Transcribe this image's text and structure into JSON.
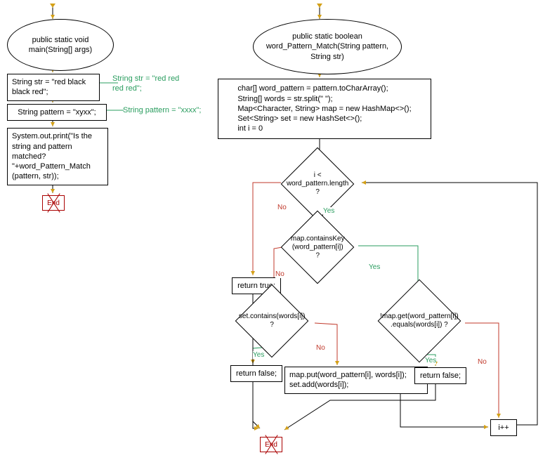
{
  "left": {
    "entry": "public static void main(String[] args)",
    "step1": "String str = \"red black black red\";",
    "step2": "String pattern = \"xyxx\";",
    "step3": "System.out.print(\"Is the string and pattern matched? \"+word_Pattern_Match (pattern, str));",
    "end": "End",
    "note1": "String str = \"red red red red\";",
    "note2": "String pattern = \"xxxx\";"
  },
  "right": {
    "entry": "public static boolean word_Pattern_Match(String pattern, String str)",
    "init": "char[] word_pattern = pattern.toCharArray();\nString[] words = str.split(\" \");\nMap<Character, String> map = new HashMap<>();\nSet<String> set = new HashSet<>();\nint i = 0",
    "cond1": "i < word_pattern.length ?",
    "cond2": "map.containsKey (word_pattern[i]) ?",
    "cond3": "set.contains(words[i]) ?",
    "cond4": "!map.get(word_pattern[i]) .equals(words[i]) ?",
    "ret_true": "return true;",
    "ret_false1": "return false;",
    "ret_false2": "return false;",
    "put": "map.put(word_pattern[i], words[i]); set.add(words[i]);",
    "inc": "i++",
    "end": "End"
  },
  "labels": {
    "yes": "Yes",
    "no": "No"
  }
}
